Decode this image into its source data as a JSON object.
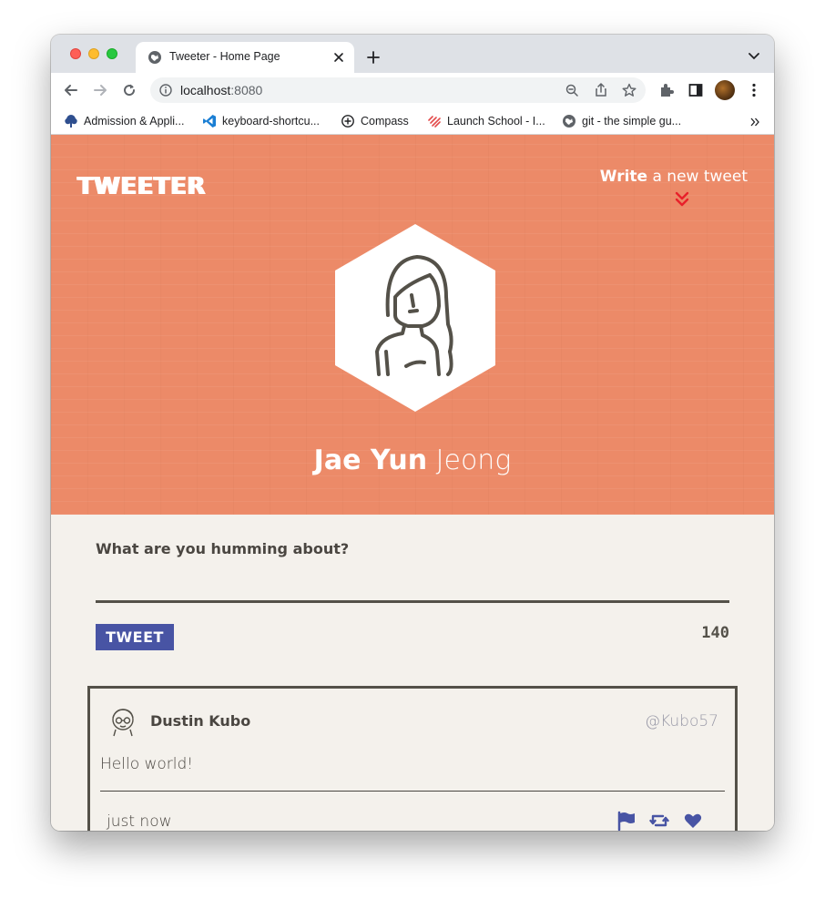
{
  "browser": {
    "tab_title": "Tweeter - Home Page",
    "url_host": "localhost",
    "url_port": ":8080",
    "bookmarks": [
      {
        "label": "Admission & Appli...",
        "icon": "tree-icon"
      },
      {
        "label": "keyboard-shortcu...",
        "icon": "vscode-icon"
      },
      {
        "label": "Compass",
        "icon": "compass-icon"
      },
      {
        "label": "Launch School - I...",
        "icon": "launch-school-icon"
      },
      {
        "label": "git - the simple gu...",
        "icon": "globe-icon"
      }
    ]
  },
  "header": {
    "logo": "TWEETER",
    "write_strong": "Write",
    "write_rest": " a new tweet"
  },
  "profile": {
    "first_name": "Jae Yun",
    "last_name": " Jeong"
  },
  "compose": {
    "label": "What are you humming about?",
    "input_value": "",
    "button_label": "TWEET",
    "counter": "140"
  },
  "tweets": [
    {
      "name": "Dustin Kubo",
      "handle": "@Kubo57",
      "body": "Hello world!",
      "time": "just now"
    }
  ],
  "colors": {
    "hero_bg": "#ec8a68",
    "accent": "#4854a4",
    "text": "#4a4641",
    "chevron": "#e8202a"
  }
}
